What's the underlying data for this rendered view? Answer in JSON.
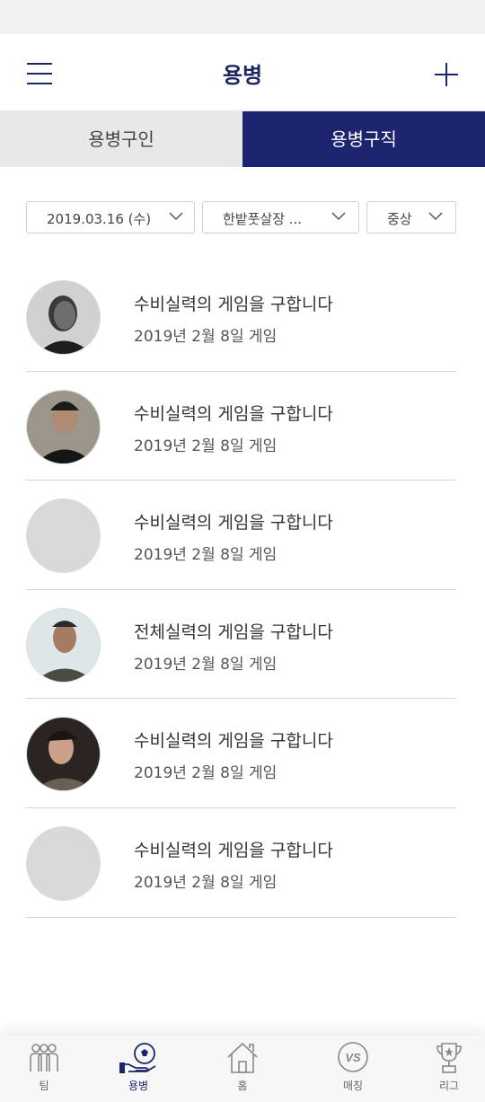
{
  "header": {
    "title": "용병"
  },
  "tabs": [
    {
      "label": "용병구인",
      "active": false
    },
    {
      "label": "용병구직",
      "active": true
    }
  ],
  "filters": {
    "date": "2019.03.16 (수)",
    "location": "한밭풋살장 ...",
    "level": "중상"
  },
  "list": [
    {
      "title": "수비실력의 게임을 구합니다",
      "date": "2019년 2월 8일 게임",
      "has_photo": true
    },
    {
      "title": "수비실력의 게임을 구합니다",
      "date": "2019년 2월 8일 게임",
      "has_photo": true
    },
    {
      "title": "수비실력의 게임을 구합니다",
      "date": "2019년 2월 8일 게임",
      "has_photo": false
    },
    {
      "title": "전체실력의 게임을 구합니다",
      "date": "2019년 2월 8일 게임",
      "has_photo": true
    },
    {
      "title": "수비실력의 게임을 구합니다",
      "date": "2019년 2월 8일 게임",
      "has_photo": true
    },
    {
      "title": "수비실력의 게임을 구합니다",
      "date": "2019년 2월 8일 게임",
      "has_photo": false
    }
  ],
  "bottom_nav": [
    {
      "label": "팀",
      "icon": "team-icon",
      "active": false
    },
    {
      "label": "용병",
      "icon": "mercenary-icon",
      "active": true
    },
    {
      "label": "홈",
      "icon": "home-icon",
      "active": false
    },
    {
      "label": "매칭",
      "icon": "vs-ball-icon",
      "active": false
    },
    {
      "label": "리그",
      "icon": "trophy-icon",
      "active": false
    }
  ],
  "colors": {
    "accent": "#1c2470",
    "inactive_tab": "#e8e8e8",
    "divider": "#d4d4d4"
  }
}
